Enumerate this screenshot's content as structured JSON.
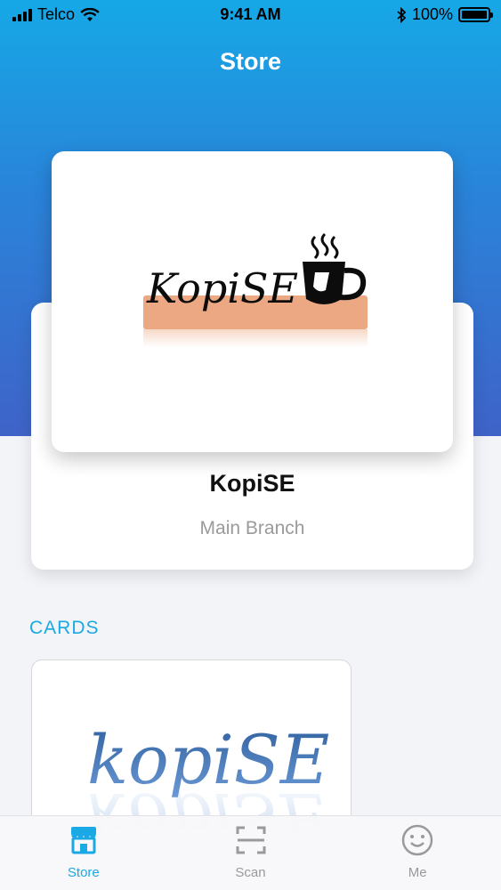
{
  "status_bar": {
    "carrier": "Telco",
    "time": "9:41 AM",
    "battery_percent": "100%",
    "battery_level": 1.0
  },
  "nav": {
    "title": "Store"
  },
  "store": {
    "logo_text": "KopiSE",
    "name": "KopiSE",
    "branch": "Main Branch"
  },
  "cards_section": {
    "title": "CARDS",
    "cards": [
      {
        "logo_text": "kopiSE"
      }
    ]
  },
  "tab_bar": {
    "tabs": [
      {
        "label": "Store",
        "icon": "store-icon",
        "active": true
      },
      {
        "label": "Scan",
        "icon": "scan-icon",
        "active": false
      },
      {
        "label": "Me",
        "icon": "smiley-icon",
        "active": false
      }
    ]
  },
  "colors": {
    "accent": "#1aa9e4",
    "gradient_top": "#16a8e6",
    "gradient_bottom": "#3f63c8",
    "logo_bar": "#eca882"
  }
}
